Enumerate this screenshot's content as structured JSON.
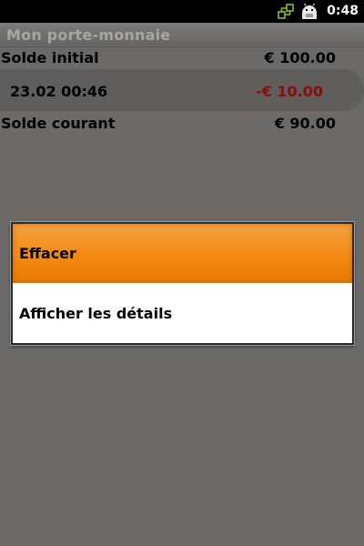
{
  "status_bar": {
    "time": "0:48",
    "icons": [
      "network-sync-icon",
      "android-usb-icon"
    ]
  },
  "app": {
    "title": "Mon porte-monnaie"
  },
  "wallet": {
    "initial_label": "Solde initial",
    "initial_amount": "€ 100.00",
    "transaction": {
      "date": "23.02 00:46",
      "amount": "-€ 10.00"
    },
    "current_label": "Solde courant",
    "current_amount": "€ 90.00"
  },
  "context_menu": {
    "items": [
      {
        "label": "Effacer",
        "selected": true
      },
      {
        "label": "Afficher les détails",
        "selected": false
      }
    ]
  },
  "colors": {
    "accent": "#f38a12",
    "negative": "#8a0d0d",
    "dim_background": "#6b6a68"
  }
}
